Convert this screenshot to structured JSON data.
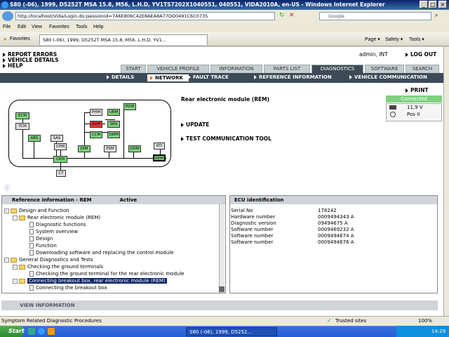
{
  "window": {
    "title": "S80 (-06), 1999, D5252T MSA 15.8, M56, L.H.D, YV1TS7202X1040551, 040551, VIDA2010A, en-US - Windows Internet Explorer",
    "min": "_",
    "max": "□",
    "close": "×"
  },
  "browser": {
    "url": "http://localhost/Vida/Login.do;jsessionid=7A6E806C42E8AEA8A77DD0491C6C0735",
    "search_placeholder": "Google",
    "menu": [
      "File",
      "Edit",
      "View",
      "Favorites",
      "Tools",
      "Help"
    ],
    "favorites_label": "Favorites",
    "tab_title": "S80 (-06), 1999, D5252T MSA 15.8, M56, L.H.D, YV1...",
    "commands": [
      "Page ▾",
      "Safety ▾",
      "Tools ▾"
    ]
  },
  "vida": {
    "top_links": [
      "REPORT ERRORS",
      "VEHICLE DETAILS",
      "HELP"
    ],
    "user": "admin, INT",
    "logout": "LOG OUT",
    "tabs": [
      "START",
      "VEHICLE PROFILE",
      "INFORMATION",
      "PARTS LIST",
      "DIAGNOSTICS",
      "SOFTWARE",
      "SEARCH"
    ],
    "active_tab": "DIAGNOSTICS",
    "subtabs": [
      "DETAILS",
      "NETWORK",
      "FAULT TRACE",
      "REFERENCE INFORMATION",
      "VEHICLE COMMUNICATION"
    ],
    "active_subtab": "NETWORK",
    "print": "PRINT",
    "module_title": "Rear electronic module (REM)",
    "actions": [
      "UPDATE",
      "TEST COMMUNICATION TOOL"
    ],
    "connection": {
      "status": "Connected",
      "voltage": "11,9 V",
      "position": "Pos II"
    },
    "network_nodes": {
      "ecm": "ECM",
      "tcm": "TCM",
      "abs": "ABS",
      "sas": "SAS",
      "cpm": "CPM",
      "cem": "CEM",
      "ct": "CT",
      "phm": "PHM",
      "uem": "UEM",
      "pdm": "PDM",
      "aum": "AUM",
      "srs": "SRS",
      "ccm": "CCM",
      "swm": "SWM",
      "dim": "DIM",
      "psm": "PSM",
      "ddm": "DDM",
      "rti": "RTI",
      "rem": "REM"
    },
    "reference": {
      "header": "Reference information - REM",
      "status": "Active",
      "tree": [
        {
          "label": "Design and Function",
          "level": 0,
          "type": "folder"
        },
        {
          "label": "Rear electronic module (REM)",
          "level": 1,
          "type": "folder"
        },
        {
          "label": "Diagnostic functions",
          "level": 2,
          "type": "doc"
        },
        {
          "label": "System overview",
          "level": 2,
          "type": "doc"
        },
        {
          "label": "Design",
          "level": 2,
          "type": "doc"
        },
        {
          "label": "Function",
          "level": 2,
          "type": "doc"
        },
        {
          "label": "Downloading software and replacing the control module",
          "level": 2,
          "type": "doc"
        },
        {
          "label": "General Diagnostics and Tests",
          "level": 0,
          "type": "folder"
        },
        {
          "label": "Checking the ground terminals",
          "level": 1,
          "type": "folder"
        },
        {
          "label": "Checking the ground terminal for the rear electronic module",
          "level": 2,
          "type": "doc"
        },
        {
          "label": "Connecting breakout box, rear electronic module (REM)",
          "level": 1,
          "type": "folder",
          "selected": true
        },
        {
          "label": "Connecting the breakout box",
          "level": 2,
          "type": "doc"
        }
      ]
    },
    "ecu": {
      "header": "ECU identification",
      "rows": [
        {
          "label": "Serial No",
          "value": "178242"
        },
        {
          "label": "Hardware number",
          "value": "0009494343  A"
        },
        {
          "label": "Diagnostic version",
          "value": "09494675  A"
        },
        {
          "label": "Software number",
          "value": "0009469232  A"
        },
        {
          "label": "Software number",
          "value": "0009494674  A"
        },
        {
          "label": "Software number",
          "value": "0009494676  A"
        }
      ]
    },
    "view_information": "VIEW INFORMATION"
  },
  "status": {
    "text": "Symptom Related Diagnostic Procedures",
    "zone": "Trusted sites",
    "zoom": "100%"
  },
  "taskbar": {
    "start": "Start",
    "task": "S80 (-06), 1999, D5252...",
    "clock": "14:29"
  }
}
